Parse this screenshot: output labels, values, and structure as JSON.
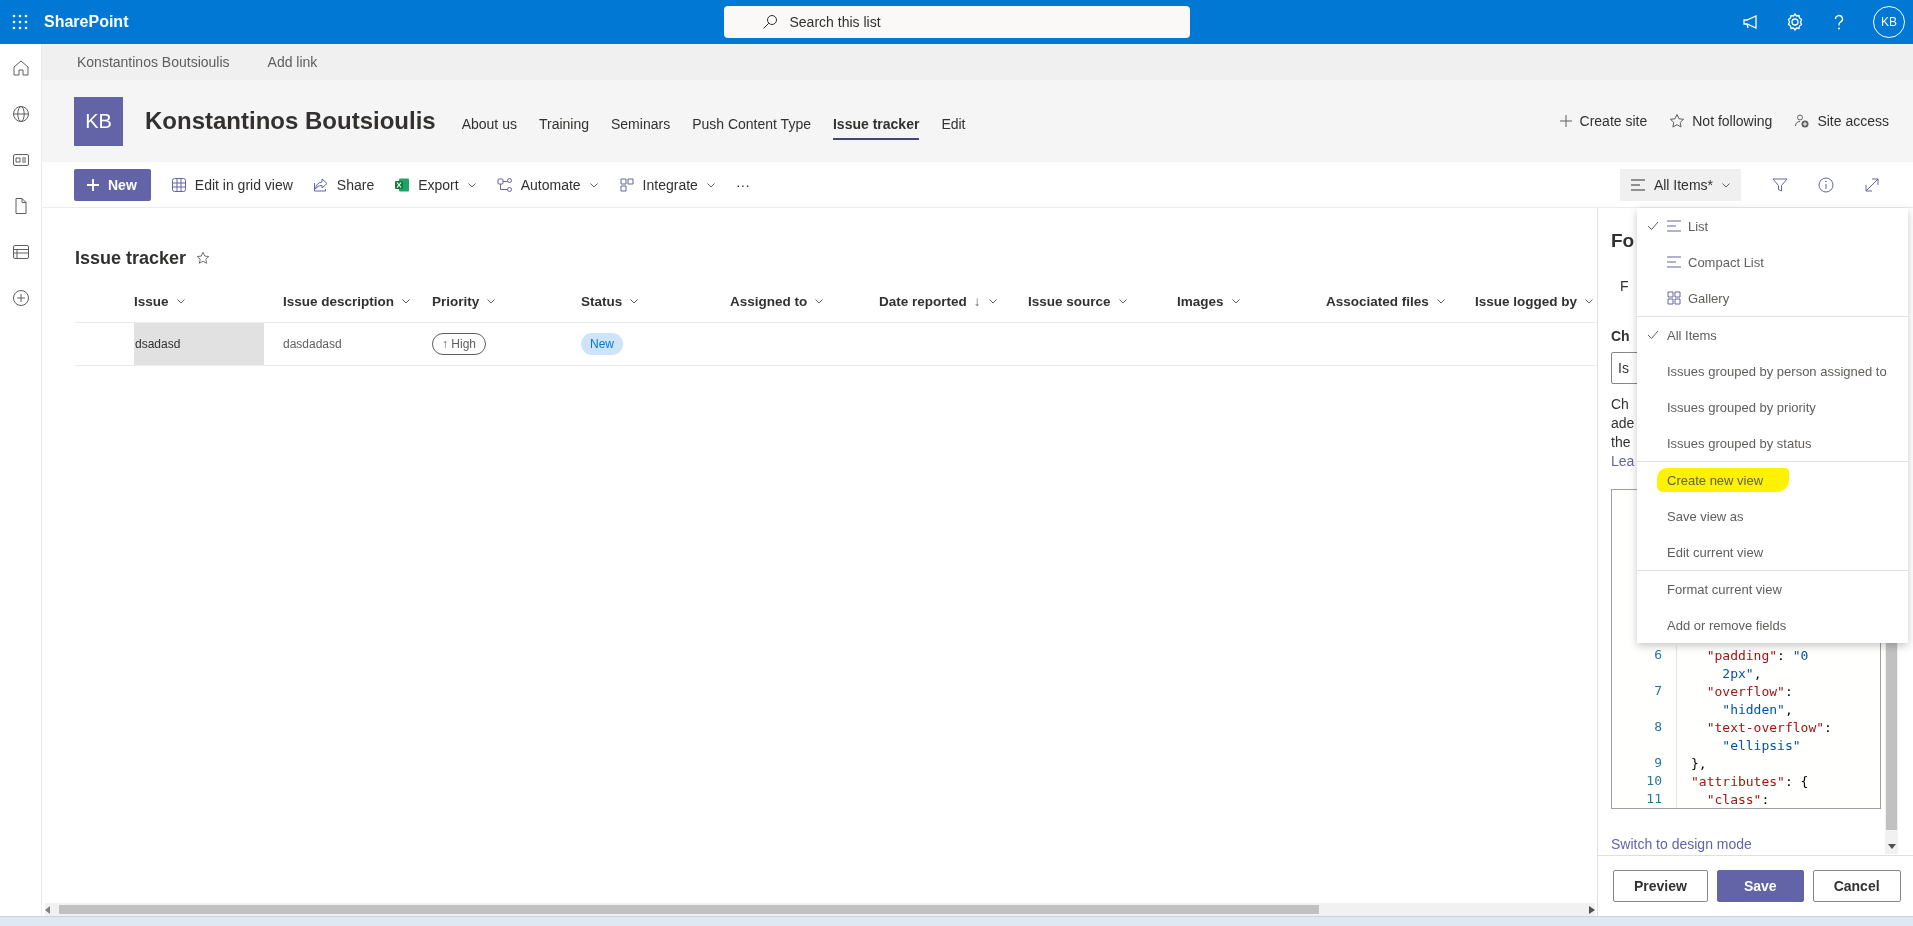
{
  "top_bar": {
    "app_name": "SharePoint",
    "search": {
      "placeholder": "Search this list"
    },
    "avatar": "KB"
  },
  "hub_nav": {
    "items": [
      "Konstantinos Boutsioulis",
      "Add link"
    ]
  },
  "site_header": {
    "logo": "KB",
    "title": "Konstantinos Boutsioulis",
    "nav": [
      {
        "label": "About us",
        "selected": false
      },
      {
        "label": "Training",
        "selected": false
      },
      {
        "label": "Seminars",
        "selected": false
      },
      {
        "label": "Push Content Type",
        "selected": false
      },
      {
        "label": "Issue tracker",
        "selected": true
      },
      {
        "label": "Edit",
        "selected": false
      }
    ],
    "actions": [
      {
        "label": "Create site",
        "kind": "plus"
      },
      {
        "label": "Not following",
        "kind": "star"
      },
      {
        "label": "Site access",
        "kind": "people"
      }
    ]
  },
  "command_bar": {
    "new_button": "New",
    "commands": [
      {
        "label": "Edit in grid view",
        "kind": "grid",
        "dropdown": false
      },
      {
        "label": "Share",
        "kind": "share",
        "dropdown": false
      },
      {
        "label": "Export",
        "kind": "excel",
        "dropdown": true
      },
      {
        "label": "Automate",
        "kind": "flow",
        "dropdown": true
      },
      {
        "label": "Integrate",
        "kind": "apps",
        "dropdown": true
      }
    ],
    "more": "···",
    "view_button": "All Items*"
  },
  "list": {
    "title": "Issue tracker",
    "favorite": false,
    "columns": [
      {
        "label": "Issue"
      },
      {
        "label": "Issue description"
      },
      {
        "label": "Priority"
      },
      {
        "label": "Status"
      },
      {
        "label": "Assigned to"
      },
      {
        "label": "Date reported",
        "sort_indicator": "↓"
      },
      {
        "label": "Issue source"
      },
      {
        "label": "Images"
      },
      {
        "label": "Associated files"
      },
      {
        "label": "Issue logged by"
      }
    ],
    "rows": [
      {
        "issue": "dsadasd",
        "issue_description": "dasdadasd",
        "priority": "↑ High",
        "status": "New",
        "selected": false
      }
    ]
  },
  "format_panel": {
    "title": "Fo",
    "tab": "F",
    "field_label": "Ch",
    "field_value": "Is",
    "description_lines": [
      "Ch",
      "ade",
      "the"
    ],
    "link": "Lea",
    "code_rows": [
      {
        "number": "6",
        "tokens": [
          {
            "kind": "key",
            "text": "  \"padding\""
          },
          {
            "kind": "punct",
            "text": ": "
          },
          {
            "kind": "string",
            "text": "\"0"
          }
        ]
      },
      {
        "tokens": [
          {
            "kind": "string",
            "text": "    2px\""
          },
          {
            "kind": "punct",
            "text": ","
          }
        ]
      },
      {
        "number": "7",
        "tokens": [
          {
            "kind": "key",
            "text": "  \"overflow\""
          },
          {
            "kind": "punct",
            "text": ":"
          }
        ]
      },
      {
        "tokens": [
          {
            "kind": "string",
            "text": "    \"hidden\""
          },
          {
            "kind": "punct",
            "text": ","
          }
        ]
      },
      {
        "number": "8",
        "tokens": [
          {
            "kind": "key",
            "text": "  \"text-overflow\""
          },
          {
            "kind": "punct",
            "text": ":"
          }
        ]
      },
      {
        "tokens": [
          {
            "kind": "string",
            "text": "    \"ellipsis\""
          }
        ]
      },
      {
        "number": "9",
        "tokens": [
          {
            "kind": "punct",
            "text": "},"
          }
        ]
      },
      {
        "number": "10",
        "tokens": [
          {
            "kind": "key",
            "text": "\"attributes\""
          },
          {
            "kind": "punct",
            "text": ": {"
          }
        ]
      },
      {
        "number": "11",
        "tokens": [
          {
            "kind": "key",
            "text": "  \"class\""
          },
          {
            "kind": "punct",
            "text": ":"
          }
        ]
      }
    ],
    "design_mode_link": "Switch to design mode",
    "buttons": [
      {
        "label": "Preview",
        "primary": false
      },
      {
        "label": "Save",
        "primary": true
      },
      {
        "label": "Cancel",
        "primary": false
      }
    ]
  },
  "view_menu": {
    "sections": [
      {
        "items": [
          {
            "label": "List",
            "kind": "list",
            "checked": true,
            "highlighted": false
          },
          {
            "label": "Compact List",
            "kind": "compact",
            "checked": false,
            "highlighted": false
          },
          {
            "label": "Gallery",
            "kind": "gallery",
            "checked": false,
            "highlighted": false
          }
        ]
      },
      {
        "items": [
          {
            "label": "All Items",
            "kind": "view",
            "checked": true,
            "highlighted": false
          },
          {
            "label": "Issues grouped by person assigned to",
            "kind": "view",
            "checked": false,
            "highlighted": false
          },
          {
            "label": "Issues grouped by priority",
            "kind": "view",
            "checked": false,
            "highlighted": false
          },
          {
            "label": "Issues grouped by status",
            "kind": "view",
            "checked": false,
            "highlighted": false
          }
        ]
      },
      {
        "items": [
          {
            "label": "Create new view",
            "kind": "command",
            "checked": false,
            "highlighted": true
          },
          {
            "label": "Save view as",
            "kind": "command",
            "checked": false,
            "highlighted": false
          },
          {
            "label": "Edit current view",
            "kind": "command",
            "checked": false,
            "highlighted": false
          }
        ]
      },
      {
        "items": [
          {
            "label": "Format current view",
            "kind": "command",
            "checked": false,
            "highlighted": false
          },
          {
            "label": "Add or remove fields",
            "kind": "command",
            "checked": false,
            "highlighted": false
          }
        ]
      }
    ]
  }
}
